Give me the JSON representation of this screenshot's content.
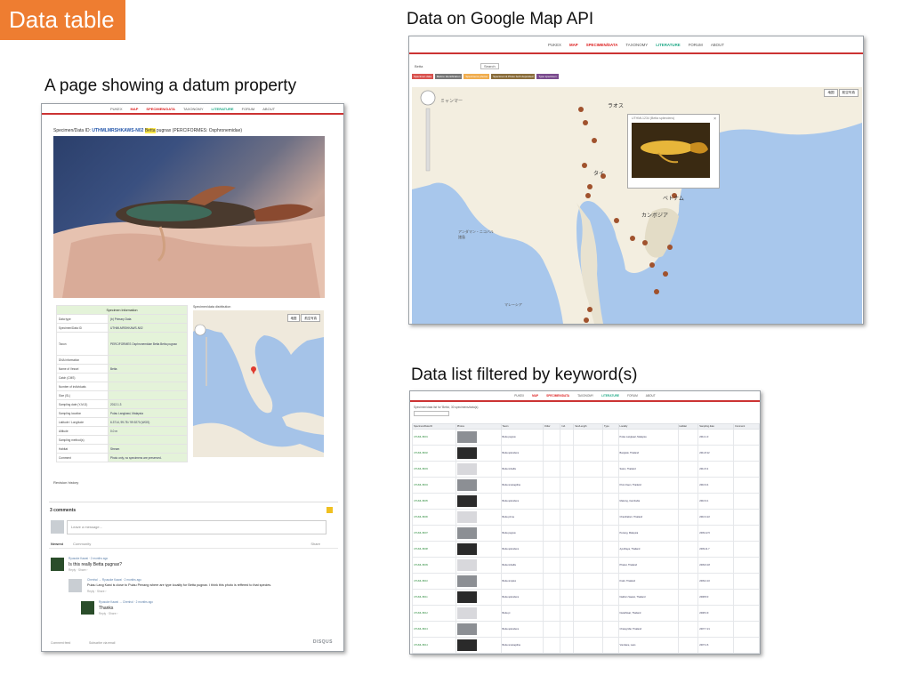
{
  "slide": {
    "title": "Data table",
    "captions": {
      "datum": "A page showing a datum property",
      "map": "Data on Google Map API",
      "list": "Data list filtered by keyword(s)"
    },
    "colors": {
      "title_badge": "#ee7d31",
      "nav_accent": "#cc3333"
    }
  },
  "nav": [
    "PUKEX",
    "MAP",
    "SPECIMEN/DATA",
    "TAXONOMY",
    "LITERATURE",
    "FORUM",
    "ABOUT"
  ],
  "datum_page": {
    "specimen_line_prefix": "Specimen/Data ID:",
    "specimen_id": "UTHMLMRSHKAWS-N02",
    "specimen_taxon_hl": "Betta",
    "specimen_taxon_rest": "pugnax (PERCIFORMES: Osphronemidae)",
    "info_header": "Specimen Information",
    "info_rows": [
      {
        "k": "Data type",
        "v": "(b) Primary Data"
      },
      {
        "k": "Specimen/Data ID",
        "v": "UTHMLMRSHKAWS-N02"
      },
      {
        "k": "Taxon",
        "v": "PERCIFORMES Osphronemidae Betta Betta pugnax"
      },
      {
        "k": "DNA information",
        "v": ""
      },
      {
        "k": "Name of Vessel",
        "v": "Betta"
      },
      {
        "k": "Catch (CMS)",
        "v": ""
      },
      {
        "k": "Number of individuals",
        "v": ""
      },
      {
        "k": "Size (SL)",
        "v": ""
      },
      {
        "k": "Sampling date (Y-M-D)",
        "v": "2012.1.3"
      },
      {
        "k": "Sampling location",
        "v": "Pulau Langkawi, Malaysia"
      },
      {
        "k": "Latitude / Longitude",
        "v": "6.3714, 99.78 / 99.9270 (WGS)"
      },
      {
        "k": "Altitude",
        "v": "0.0 m"
      },
      {
        "k": "Sampling method(s)",
        "v": ""
      },
      {
        "k": "Habitat",
        "v": "Stream"
      },
      {
        "k": "Comment",
        "v": "Photo only, no specimens are preserved."
      }
    ],
    "map_title": "Specimen/data distribution",
    "map_buttons": [
      "地図",
      "航空写真"
    ],
    "revision_history": "Revision history",
    "comments": {
      "count": "3 comments",
      "placeholder": "Leave a message...",
      "tabs": [
        "Newest",
        "Community"
      ],
      "share": "Share",
      "items": [
        {
          "meta": "Ryusuke Kawai  ·  2 months ago",
          "text": "Is this really Betta pugnax?",
          "actions": "Reply  ·  Share ›"
        },
        {
          "meta": "Chenhol  →  Ryusuke Kawai  ·  2 months ago",
          "text": "Pulau Lang Kawi is close to Pulau Penang where are type locality for Betta pugnax. I think this photo is reffered to that species.",
          "actions": "Reply  ·  Share ›"
        },
        {
          "meta": "Ryusuke Kawai  →  Chenhol  ·  2 months ago",
          "text": "Thanks",
          "actions": "Reply  ·  Share ›"
        }
      ],
      "footer_left": "Comment feed",
      "footer_mid": "Subscribe via email",
      "brand": "DISQUS"
    }
  },
  "map_page": {
    "search_text": "Betta",
    "search_button": "Search",
    "legend": [
      {
        "label": "Specimen data",
        "color": "#d9534f"
      },
      {
        "label": "Before identification",
        "color": "#777777"
      },
      {
        "label": "Specimens photos",
        "color": "#f0ad4e"
      },
      {
        "label": "Specimen & Photo both deposited",
        "color": "#8a6d3b"
      },
      {
        "label": "Type specimen",
        "color": "#7a4b8e"
      }
    ],
    "map_buttons": [
      "地図",
      "航空写真"
    ],
    "place_labels": [
      "ミャンマー",
      "ラオス",
      "タイ",
      "ベトナム",
      "カンボジア",
      "アンダマン・ニコバル諸島",
      "マレーシア"
    ],
    "popup_title": "UTHML1234 (Betta splendens)"
  },
  "list_page": {
    "filter_label": "Specimen/data list for 'Betta', 30 specimens/data(s)",
    "headers": [
      "Specimen/Data ID",
      "Photos",
      "Taxon",
      "Order",
      "Ind.",
      "Sex/Length",
      "Type",
      "Locality",
      "Habitat",
      "Sampling date",
      "Comment"
    ],
    "rows": [
      {
        "id": "UTHML-B001",
        "taxon": "Betta pugnax",
        "locality": "Pulau Langkawi, Malaysia",
        "date": "2012.1.3"
      },
      {
        "id": "UTHML-B002",
        "taxon": "Betta splendens",
        "locality": "Bangkok, Thailand",
        "date": "2011.8.12"
      },
      {
        "id": "UTHML-B003",
        "taxon": "Betta imbellis",
        "locality": "Satun, Thailand",
        "date": "2011.5.2"
      },
      {
        "id": "UTHML-B004",
        "taxon": "Betta smaragdina",
        "locality": "Khon Kaen, Thailand",
        "date": "2010.9.4"
      },
      {
        "id": "UTHML-B005",
        "taxon": "Betta splendens",
        "locality": "Mekong, Cambodia",
        "date": "2010.9.1"
      },
      {
        "id": "UTHML-B006",
        "taxon": "Betta prima",
        "locality": "Chanthaburi, Thailand",
        "date": "2010.3.22"
      },
      {
        "id": "UTHML-B007",
        "taxon": "Betta pugnax",
        "locality": "Penang, Malaysia",
        "date": "2009.12.5"
      },
      {
        "id": "UTHML-B008",
        "taxon": "Betta splendens",
        "locality": "Ayutthaya, Thailand",
        "date": "2009.11.7"
      },
      {
        "id": "UTHML-B009",
        "taxon": "Betta imbellis",
        "locality": "Phuket, Thailand",
        "date": "2009.6.18"
      },
      {
        "id": "UTHML-B010",
        "taxon": "Betta simplex",
        "locality": "Krabi, Thailand",
        "date": "2009.4.10"
      },
      {
        "id": "UTHML-B011",
        "taxon": "Betta splendens",
        "locality": "Nakhon Sawan, Thailand",
        "date": "2008.8.3"
      },
      {
        "id": "UTHML-B012",
        "taxon": "Betta pi",
        "locality": "Narathiwat, Thailand",
        "date": "2008.3.9"
      },
      {
        "id": "UTHML-B013",
        "taxon": "Betta splendens",
        "locality": "Chiang Mai, Thailand",
        "date": "2007.7.21"
      },
      {
        "id": "UTHML-B014",
        "taxon": "Betta smaragdina",
        "locality": "Vientiane, Laos",
        "date": "2007.2.6"
      }
    ]
  }
}
